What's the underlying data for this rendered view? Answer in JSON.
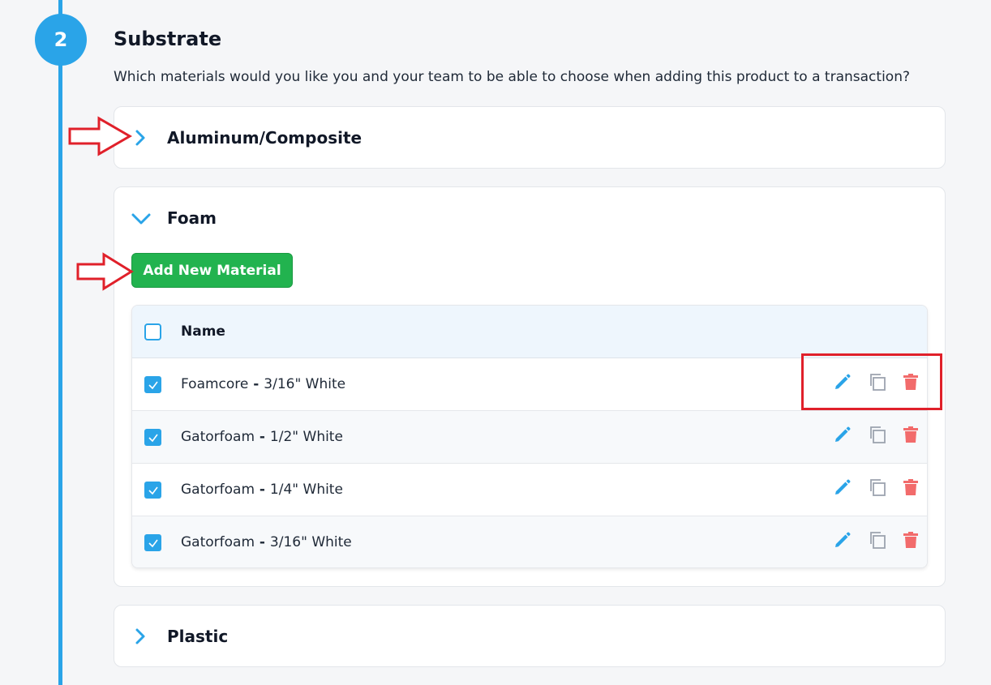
{
  "step": {
    "number": "2",
    "title": "Substrate",
    "description": "Which materials would you like you and your team to be able to choose when adding this product to a transaction?"
  },
  "categories": [
    {
      "label": "Aluminum/Composite",
      "expanded": false
    },
    {
      "label": "Foam",
      "expanded": true
    },
    {
      "label": "Plastic",
      "expanded": false
    }
  ],
  "foam": {
    "add_button_label": "Add New Material",
    "table_header": "Name",
    "rows": [
      {
        "name": "Foamcore",
        "sep": " - ",
        "spec": "3/16\" White",
        "checked": true
      },
      {
        "name": "Gatorfoam",
        "sep": " - ",
        "spec": "1/2\" White",
        "checked": true
      },
      {
        "name": "Gatorfoam",
        "sep": " - ",
        "spec": "1/4\" White",
        "checked": true
      },
      {
        "name": "Gatorfoam",
        "sep": " - ",
        "spec": "3/16\" White",
        "checked": true
      }
    ]
  },
  "colors": {
    "accent": "#2aa4e8",
    "add_button": "#22b34f",
    "delete": "#f26b6b",
    "copy": "#9ca3af",
    "annotation": "#e0202a"
  },
  "icons": {
    "row_actions": [
      "pencil-icon",
      "copy-icon",
      "trash-icon"
    ],
    "expand": "chevron-right-icon",
    "collapse": "chevron-down-icon"
  }
}
